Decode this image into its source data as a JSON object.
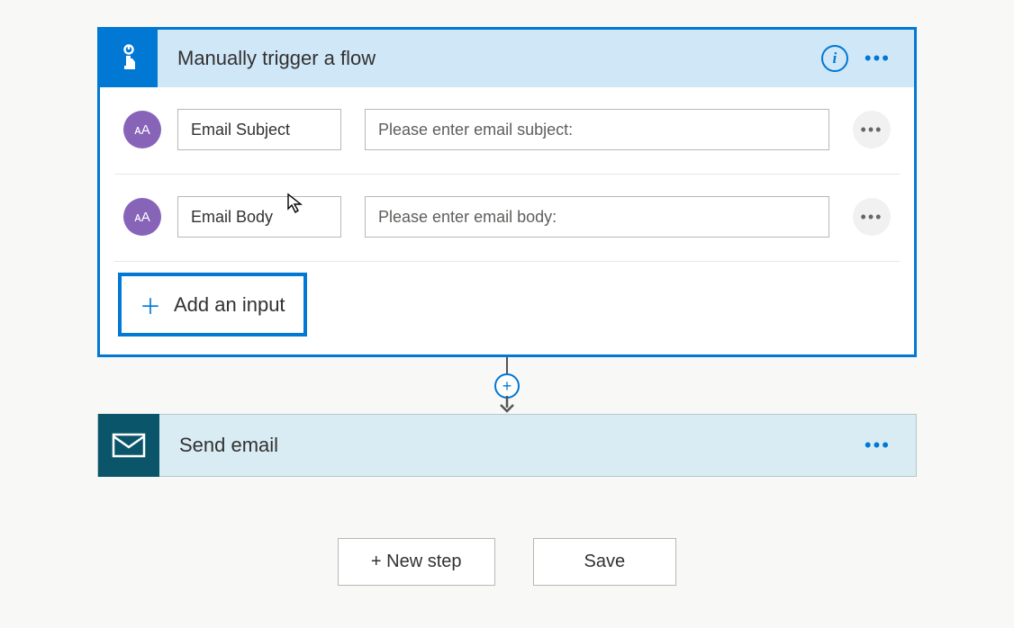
{
  "trigger": {
    "title": "Manually trigger a flow",
    "inputs": [
      {
        "name": "Email Subject",
        "prompt": "Please enter email subject:",
        "typeGlyph": "ᴀA"
      },
      {
        "name": "Email Body",
        "prompt": "Please enter email body:",
        "typeGlyph": "ᴀA"
      }
    ],
    "addInputLabel": "Add an input"
  },
  "action": {
    "title": "Send email"
  },
  "footer": {
    "newStepLabel": "+ New step",
    "saveLabel": "Save"
  },
  "colors": {
    "primary": "#0078d4",
    "triggerHeaderBg": "#d0e7f8",
    "actionBg": "#d9ecf4",
    "actionIconBg": "#0b556a",
    "textBadgeBg": "#8764b8"
  }
}
